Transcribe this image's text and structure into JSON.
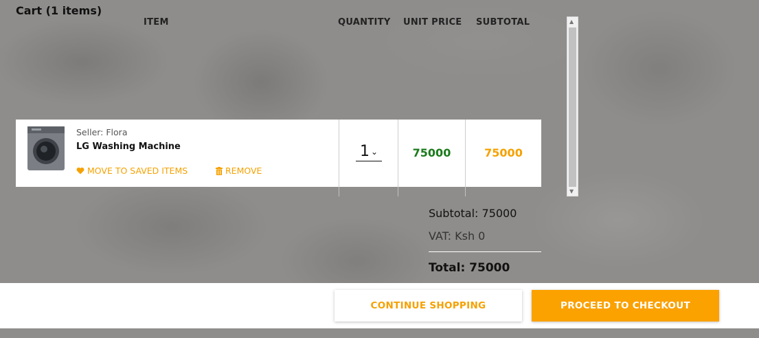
{
  "cart": {
    "title": "Cart (1 items)"
  },
  "columns": {
    "item": "ITEM",
    "quantity": "QUANTITY",
    "unit_price": "UNIT PRICE",
    "subtotal": "SUBTOTAL"
  },
  "items": [
    {
      "seller": "Seller: Flora",
      "name": "LG Washing Machine",
      "image_icon": "washing-machine-image",
      "save_label": "MOVE TO SAVED ITEMS",
      "remove_label": "REMOVE",
      "quantity": "1",
      "unit_price": "75000",
      "subtotal": "75000"
    }
  ],
  "summary": {
    "subtotal": "Subtotal: 75000",
    "vat": "VAT: Ksh 0",
    "total": "Total: 75000"
  },
  "buttons": {
    "continue": "CONTINUE SHOPPING",
    "checkout": "PROCEED TO CHECKOUT"
  },
  "colors": {
    "accent": "#f5a100",
    "unit_price": "#1a7a1a",
    "subtotal": "#f5a100"
  }
}
